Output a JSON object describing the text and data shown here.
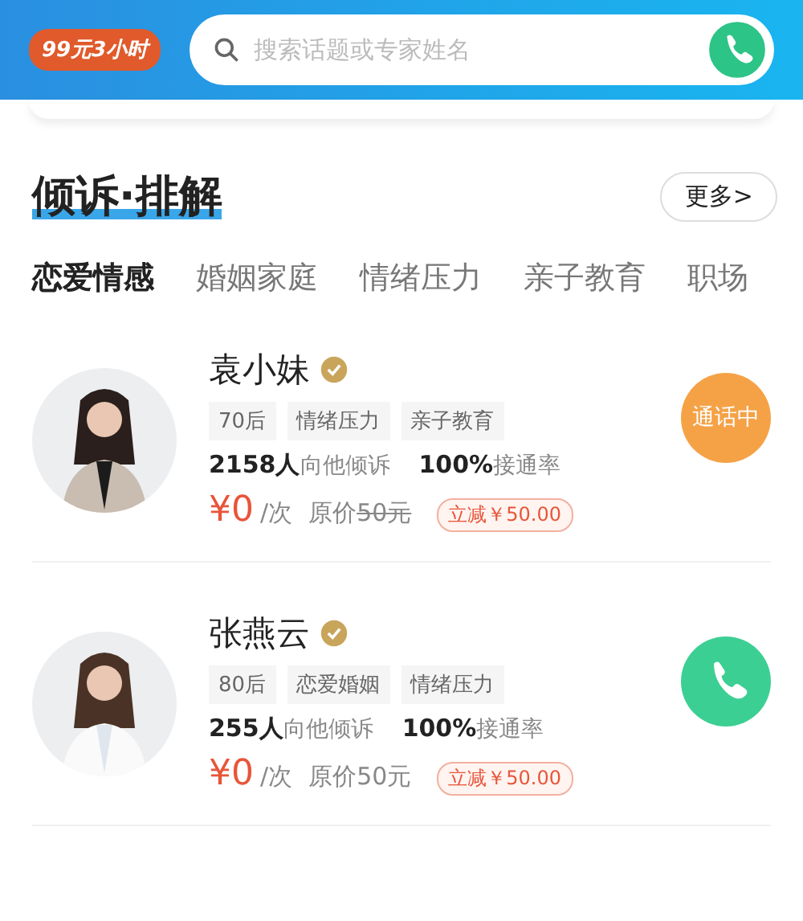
{
  "header": {
    "promo_badge": "99元3小时",
    "search": {
      "placeholder": "搜索话题或专家姓名"
    }
  },
  "section": {
    "title": "倾诉·排解",
    "more_button": "更多>"
  },
  "tabs": [
    {
      "label": "恋爱情感",
      "selected": true
    },
    {
      "label": "婚姻家庭",
      "selected": false
    },
    {
      "label": "情绪压力",
      "selected": false
    },
    {
      "label": "亲子教育",
      "selected": false
    },
    {
      "label": "职场",
      "selected": false
    }
  ],
  "experts": [
    {
      "name": "袁小妹",
      "verified": true,
      "tags": [
        "70后",
        "情绪压力",
        "亲子教育"
      ],
      "listeners": "**2158人**向他倾诉",
      "answer_rate": "**100%**接通率",
      "price": "¥0",
      "unit": "/次",
      "original_label": "原价",
      "original_price": "50元",
      "original_struck": true,
      "discount": "立减￥50.00",
      "status": {
        "kind": "busy",
        "label": "通话中"
      }
    },
    {
      "name": "张燕云",
      "verified": true,
      "tags": [
        "80后",
        "恋爱婚姻",
        "情绪压力"
      ],
      "listeners": "**255人**向他倾诉",
      "answer_rate": "**100%**接通率",
      "price": "¥0",
      "unit": "/次",
      "original_label": "原价",
      "original_price": "50元",
      "original_struck": false,
      "discount": "立减￥50.00",
      "status": {
        "kind": "call"
      }
    }
  ]
}
